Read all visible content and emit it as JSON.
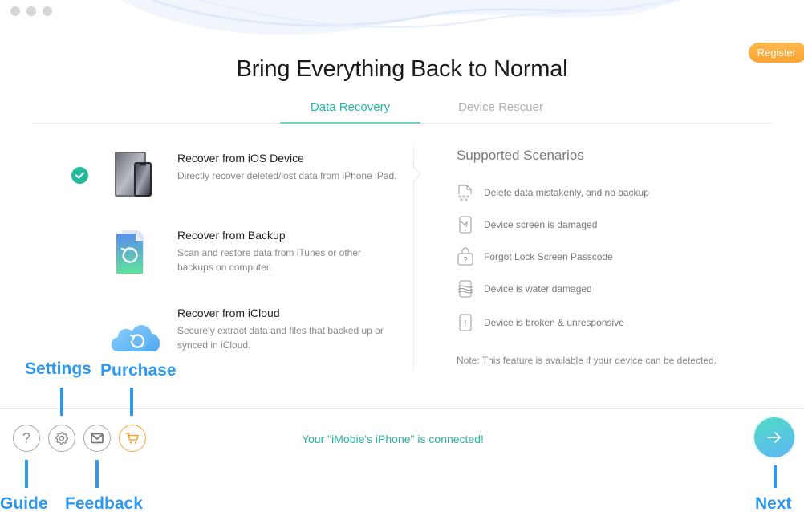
{
  "window": {
    "traffic_lights": [
      "close",
      "minimize",
      "zoom"
    ],
    "register_label": "Register",
    "title": "Bring Everything Back to Normal"
  },
  "tabs": [
    {
      "label": "Data Recovery",
      "active": true
    },
    {
      "label": "Device Rescuer",
      "active": false
    }
  ],
  "options": [
    {
      "title": "Recover from iOS Device",
      "desc": "Directly recover deleted/lost data from iPhone iPad.",
      "selected": true,
      "icon": "ios-device-icon"
    },
    {
      "title": "Recover from Backup",
      "desc": "Scan and restore data from iTunes or other backups on computer.",
      "selected": false,
      "icon": "backup-file-icon"
    },
    {
      "title": "Recover from iCloud",
      "desc": "Securely extract data and files that backed up or synced in iCloud.",
      "selected": false,
      "icon": "icloud-icon"
    }
  ],
  "scenarios": {
    "title": "Supported Scenarios",
    "items": [
      {
        "text": "Delete data mistakenly, and no backup",
        "icon": "deleted-file-icon"
      },
      {
        "text": "Device screen is damaged",
        "icon": "cracked-screen-icon"
      },
      {
        "text": "Forgot Lock Screen Passcode",
        "icon": "lock-question-icon"
      },
      {
        "text": "Device is water damaged",
        "icon": "water-damage-icon"
      },
      {
        "text": "Device is broken & unresponsive",
        "icon": "broken-device-icon"
      }
    ],
    "note": "Note: This feature is available if your device can be detected."
  },
  "footer": {
    "status": "Your \"iMobie's iPhone\" is connected!",
    "buttons": [
      {
        "name": "guide",
        "icon": "question-icon"
      },
      {
        "name": "settings",
        "icon": "gear-icon"
      },
      {
        "name": "feedback",
        "icon": "mail-icon"
      },
      {
        "name": "purchase",
        "icon": "cart-icon"
      }
    ],
    "next_icon": "arrow-right-icon"
  },
  "annotations": {
    "settings": "Settings",
    "purchase": "Purchase",
    "guide": "Guide",
    "feedback": "Feedback",
    "next": "Next"
  },
  "colors": {
    "accent_teal": "#27b8a4",
    "register_orange": "#fba532",
    "annotation_blue": "#2e98ef",
    "check_green": "#20b99a"
  }
}
